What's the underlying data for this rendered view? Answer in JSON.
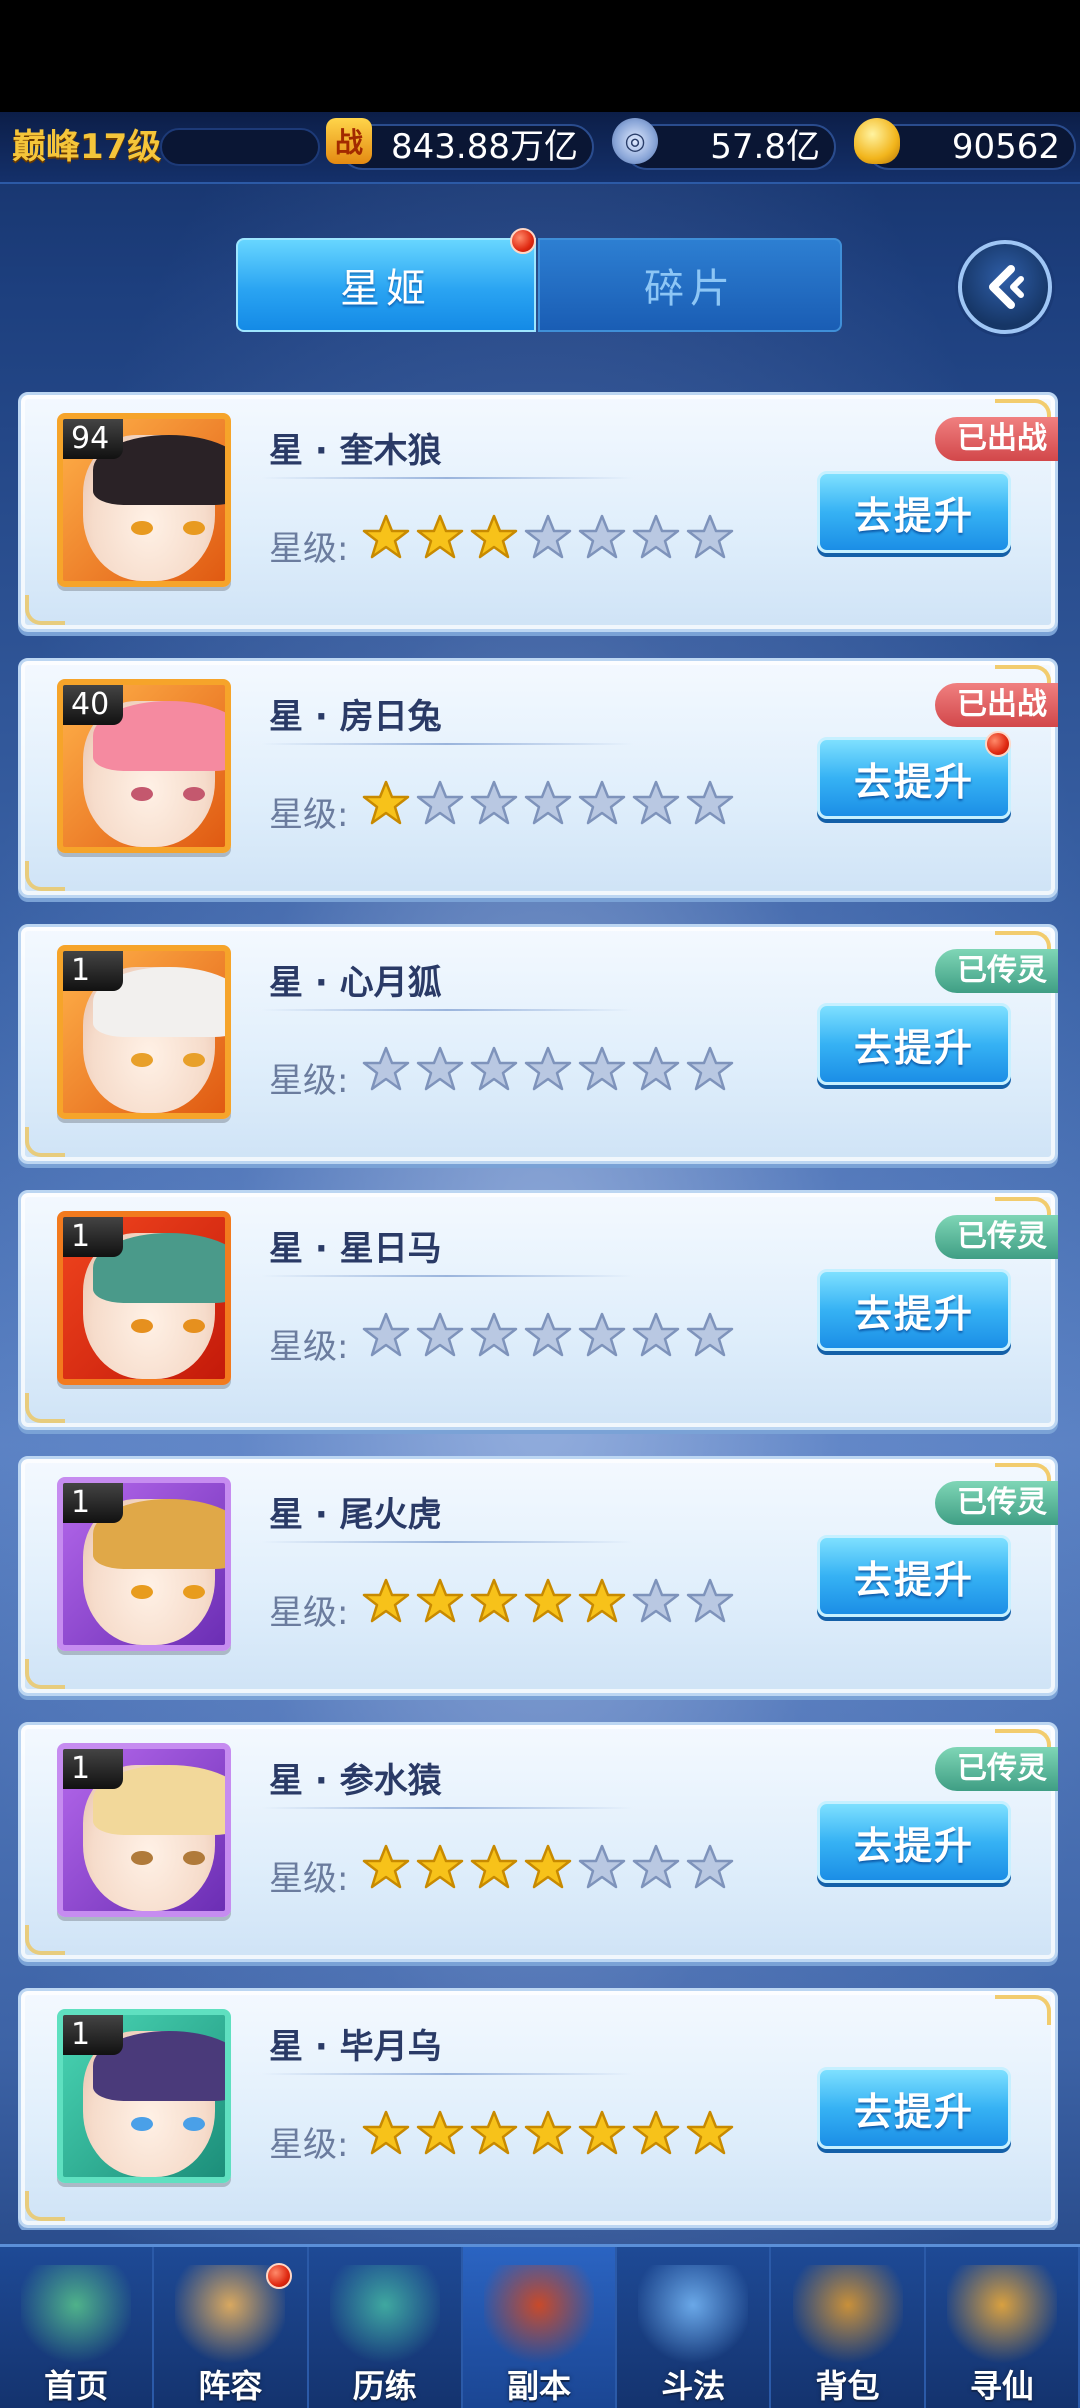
{
  "resources": {
    "rank": "巅峰17级",
    "battle_icon": "战",
    "battle_power": "843.88万亿",
    "coins": "57.8亿",
    "ingots": "90562"
  },
  "tabs": [
    {
      "label": "星姬",
      "active": true
    },
    {
      "label": "碎片",
      "active": false
    }
  ],
  "star_label": "星级:",
  "upgrade_label": "去提升",
  "characters": [
    {
      "level": "94",
      "name": "星 · 奎木狼",
      "stars": 3,
      "max_stars": 7,
      "badge": "已出战",
      "badge_type": "fight",
      "frame": "orange",
      "hair": "#2a2226",
      "eye": "#e89a20",
      "notify": false
    },
    {
      "level": "40",
      "name": "星 · 房日兔",
      "stars": 1,
      "max_stars": 7,
      "badge": "已出战",
      "badge_type": "fight",
      "frame": "orange",
      "hair": "#f58aa0",
      "eye": "#c4586e",
      "notify": true
    },
    {
      "level": "1",
      "name": "星 · 心月狐",
      "stars": 0,
      "max_stars": 7,
      "badge": "已传灵",
      "badge_type": "spirit",
      "frame": "orange",
      "hair": "#f2f0ee",
      "eye": "#e8a02a",
      "notify": false
    },
    {
      "level": "1",
      "name": "星 · 星日马",
      "stars": 0,
      "max_stars": 7,
      "badge": "已传灵",
      "badge_type": "spirit",
      "frame": "red",
      "hair": "#4a9a8a",
      "eye": "#e6901e",
      "notify": false
    },
    {
      "level": "1",
      "name": "星 · 尾火虎",
      "stars": 5,
      "max_stars": 7,
      "badge": "已传灵",
      "badge_type": "spirit",
      "frame": "purple",
      "hair": "#e0a848",
      "eye": "#e89c1e",
      "notify": false
    },
    {
      "level": "1",
      "name": "星 · 参水猿",
      "stars": 4,
      "max_stars": 7,
      "badge": "已传灵",
      "badge_type": "spirit",
      "frame": "purple",
      "hair": "#f2d89a",
      "eye": "#b07a3a",
      "notify": false
    },
    {
      "level": "1",
      "name": "星 · 毕月乌",
      "stars": 7,
      "max_stars": 7,
      "badge": "",
      "badge_type": "none",
      "frame": "green",
      "hair": "#4a3a7a",
      "eye": "#4aa0e8",
      "notify": false
    }
  ],
  "nav": [
    {
      "label": "首页",
      "icon": "home-icon",
      "color": "#4fb28a",
      "notify": false
    },
    {
      "label": "阵容",
      "icon": "lineup-icon",
      "color": "#d8a860",
      "notify": true
    },
    {
      "label": "历练",
      "icon": "training-icon",
      "color": "#3fa8a0",
      "notify": false
    },
    {
      "label": "副本",
      "icon": "dungeon-icon",
      "color": "#c84a2a",
      "notify": false
    },
    {
      "label": "斗法",
      "icon": "duel-icon",
      "color": "#6aa8e8",
      "notify": false
    },
    {
      "label": "背包",
      "icon": "bag-icon",
      "color": "#c8903a",
      "notify": false
    },
    {
      "label": "寻仙",
      "icon": "scroll-icon",
      "color": "#d8a040",
      "notify": false
    }
  ],
  "colors": {
    "star_on": "#f7c21a",
    "star_off": "#b9c8e2",
    "accent": "#2aa4f2"
  }
}
